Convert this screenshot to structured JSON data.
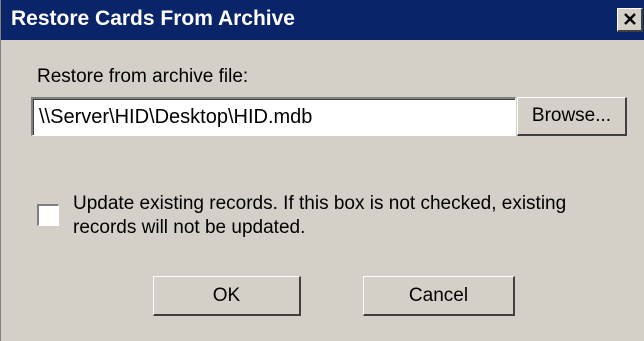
{
  "window": {
    "title": "Restore Cards From Archive"
  },
  "form": {
    "file_label": "Restore from archive file:",
    "file_path": "\\\\Server\\HID\\Desktop\\HID.mdb",
    "browse_label": "Browse...",
    "update_checkbox_checked": false,
    "update_text_line1": "Update existing records. If this box is not checked, existing",
    "update_text_line2": "records will not be updated."
  },
  "buttons": {
    "ok_label": "OK",
    "cancel_label": "Cancel"
  },
  "colors": {
    "titlebar": "#0a246a",
    "dialog_face": "#d4d0c8"
  },
  "icons": {
    "close": "close-icon"
  }
}
